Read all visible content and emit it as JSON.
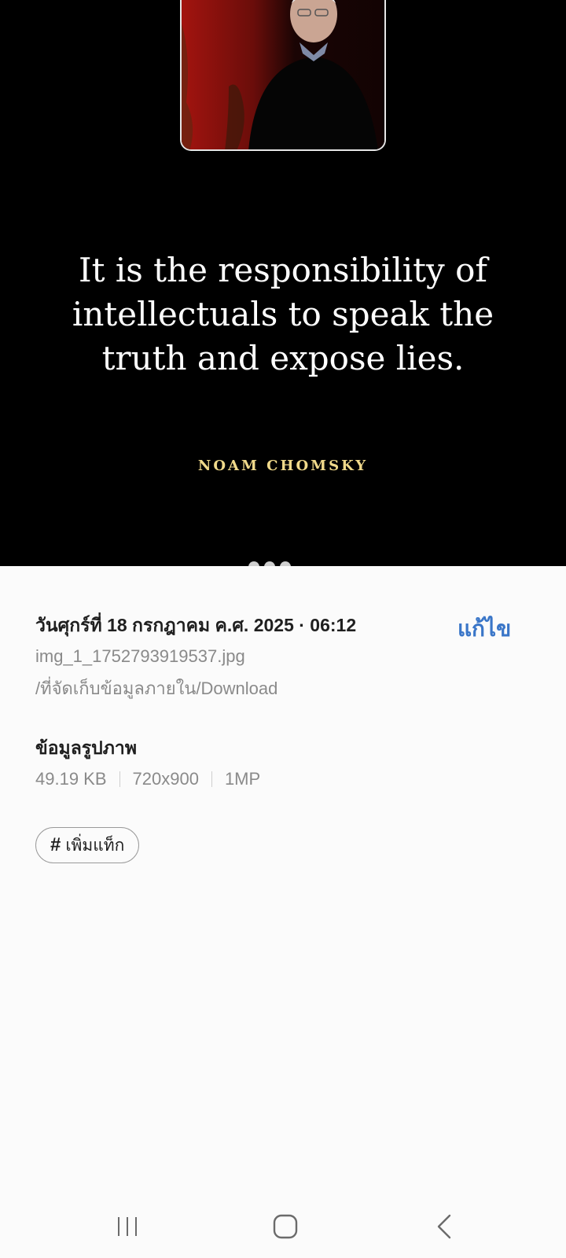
{
  "quote": {
    "line1": "It is the responsibility of",
    "line2": "intellectuals to speak the",
    "line3": "truth and expose lies.",
    "author": "NOAM CHOMSKY"
  },
  "details": {
    "date": "วันศุกร์ที่ 18 กรกฎาคม ค.ศ. 2025 · 06:12",
    "edit_label": "แก้ไข",
    "filename": "img_1_1752793919537.jpg",
    "path": "/ที่จัดเก็บข้อมูลภายใน/Download",
    "section_title": "ข้อมูลรูปภาพ",
    "file_size": "49.19 KB",
    "resolution": "720x900",
    "megapixels": "1MP",
    "tag_label": "เพิ่มแท็ก",
    "tag_symbol": "#"
  },
  "icons": {
    "recents": "recents-icon",
    "home": "home-icon",
    "back": "back-icon"
  },
  "colors": {
    "accent": "#3a76c8",
    "author_gold": "#f0d98a",
    "image_bg": "#000000",
    "sheet_bg": "#fbfbfb"
  }
}
